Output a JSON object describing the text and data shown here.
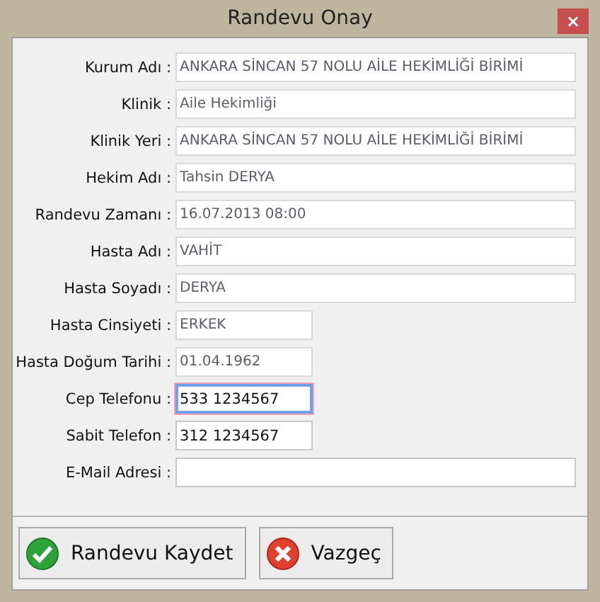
{
  "window": {
    "title": "Randevu Onay",
    "close": "×"
  },
  "fields": [
    {
      "label": "Kurum Adı :",
      "value": "ANKARA SİNCAN 57 NOLU AİLE HEKİMLİĞİ BİRİMİ",
      "kind": "long",
      "disabled": true,
      "focused": false
    },
    {
      "label": "Klinik :",
      "value": "Aile Hekimliği",
      "kind": "long",
      "disabled": true,
      "focused": false
    },
    {
      "label": "Klinik Yeri :",
      "value": "ANKARA SİNCAN 57 NOLU AİLE HEKİMLİĞİ BİRİMİ",
      "kind": "long",
      "disabled": true,
      "focused": false
    },
    {
      "label": "Hekim Adı :",
      "value": "Tahsin DERYA",
      "kind": "long",
      "disabled": true,
      "focused": false
    },
    {
      "label": "Randevu Zamanı :",
      "value": "16.07.2013 08:00",
      "kind": "long",
      "disabled": true,
      "focused": false
    },
    {
      "label": "Hasta Adı :",
      "value": "VAHİT",
      "kind": "long",
      "disabled": true,
      "focused": false
    },
    {
      "label": "Hasta Soyadı :",
      "value": "DERYA",
      "kind": "long",
      "disabled": true,
      "focused": false
    },
    {
      "label": "Hasta Cinsiyeti :",
      "value": "ERKEK",
      "kind": "short",
      "disabled": true,
      "focused": false
    },
    {
      "label": "Hasta Doğum Tarihi  :",
      "value": "01.04.1962",
      "kind": "short",
      "disabled": true,
      "focused": false
    },
    {
      "label": "Cep Telefonu :",
      "value": "533 1234567",
      "kind": "short",
      "disabled": false,
      "focused": true
    },
    {
      "label": "Sabit Telefon :",
      "value": "312 1234567",
      "kind": "short",
      "disabled": false,
      "focused": false
    },
    {
      "label": "E-Mail Adresi :",
      "kind": "long",
      "disabled": false,
      "focused": false
    }
  ],
  "buttons": [
    {
      "label": "Randevu Kaydet",
      "kind": "confirm"
    },
    {
      "label": "Vazgeç",
      "kind": "cancel"
    }
  ]
}
